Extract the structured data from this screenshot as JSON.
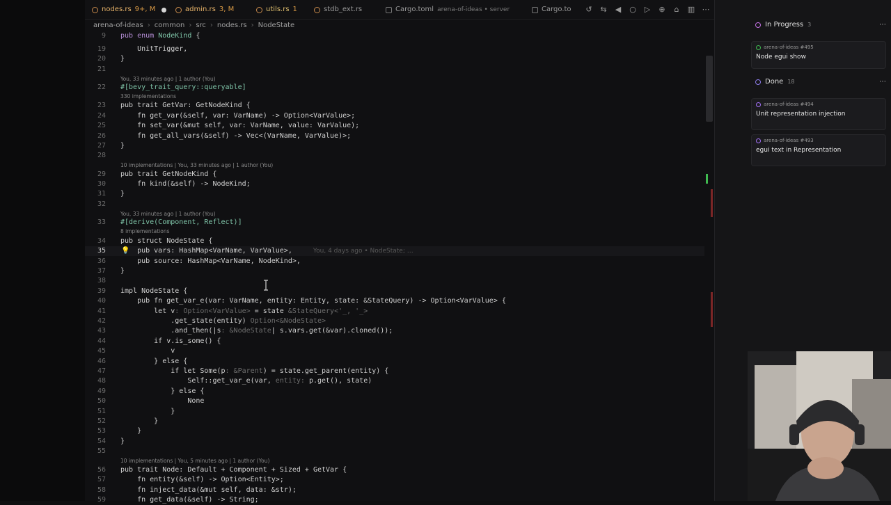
{
  "tabs": [
    {
      "name": "nodes.rs",
      "status": "9+, M",
      "active": true
    },
    {
      "name": "admin.rs",
      "status": "3, M"
    },
    {
      "name": "utils.rs",
      "status": "1"
    },
    {
      "name": "stdb_ext.rs",
      "status": ""
    },
    {
      "name": "Cargo.toml",
      "status": "arena-of-ideas • server"
    },
    {
      "name": "Cargo.to",
      "status": ""
    }
  ],
  "breadcrumb": [
    "arena-of-ideas",
    "common",
    "src",
    "nodes.rs",
    "NodeState"
  ],
  "code": {
    "l9": "pub enum NodeKind {",
    "l19": "    UnitTrigger,",
    "l20": "}",
    "lens22": "You, 33 minutes ago | 1 author (You)",
    "l22": "#[bevy_trait_query::queryable]",
    "lens22b": "330 implementations",
    "l23": "pub trait GetVar: GetNodeKind {",
    "l24": "    fn get_var(&self, var: VarName) -> Option<VarValue>;",
    "l25": "    fn set_var(&mut self, var: VarName, value: VarValue);",
    "l26": "    fn get_all_vars(&self) -> Vec<(VarName, VarValue)>;",
    "l27": "}",
    "lens29": "10 implementations | You, 33 minutes ago | 1 author (You)",
    "l29": "pub trait GetNodeKind {",
    "l30": "    fn kind(&self) -> NodeKind;",
    "l31": "}",
    "lens33": "You, 33 minutes ago | 1 author (You)",
    "l33": "#[derive(Component, Reflect)]",
    "lens33b": "8 implementations",
    "l34": "pub struct NodeState {",
    "l35": "    pub vars: HashMap<VarName, VarValue>,",
    "blame35": "You, 4 days ago • NodeState; …",
    "l36": "    pub source: HashMap<VarName, NodeKind>,",
    "l37": "}",
    "l39": "impl NodeState {",
    "l40": "    pub fn get_var_e(var: VarName, entity: Entity, state: &StateQuery) -> Option<VarValue> {",
    "l41a": "        let v",
    "l41hint": ": Option<VarValue>",
    "l41b": " = state",
    "l41hint2": " &StateQuery<'_, '_>",
    "l42a": "            .get_state(entity)",
    "l42hint": " Option<&NodeState>",
    "l43a": "            .and_then(|s",
    "l43hint": ": &NodeState",
    "l43b": "| s.vars.get(&var).cloned());",
    "l44": "        if v.is_some() {",
    "l45": "            v",
    "l46": "        } else {",
    "l47a": "            if let Some(p",
    "l47hint": ": &Parent",
    "l47b": ") = state.get_parent(entity) {",
    "l48a": "                Self::get_var_e(var, ",
    "l48hint": "entity: ",
    "l48b": "p.get(), state)",
    "l49": "            } else {",
    "l50": "                None",
    "l51": "            }",
    "l52": "        }",
    "l53": "    }",
    "l54": "}",
    "lens56": "10 implementations | You, 5 minutes ago | 1 author (You)",
    "l56": "pub trait Node: Default + Component + Sized + GetVar {",
    "l57": "    fn entity(&self) -> Option<Entity>;",
    "l58": "    fn inject_data(&mut self, data: &str);",
    "l59": "    fn get_data(&self) -> String;"
  },
  "line_numbers": [
    "9",
    "19",
    "20",
    "21",
    "22",
    "23",
    "24",
    "25",
    "26",
    "27",
    "28",
    "29",
    "30",
    "31",
    "32",
    "33",
    "34",
    "35",
    "36",
    "37",
    "38",
    "39",
    "40",
    "41",
    "42",
    "43",
    "44",
    "45",
    "46",
    "47",
    "48",
    "49",
    "50",
    "51",
    "52",
    "53",
    "54",
    "55",
    "56",
    "57",
    "58",
    "59"
  ],
  "current_line": "35",
  "project_panel": {
    "groups": [
      {
        "label": "In Progress",
        "count": "3",
        "cards": [
          {
            "repo": "arena-of-ideas #495",
            "title": "Node egui show"
          }
        ]
      },
      {
        "label": "Done",
        "count": "18",
        "cards": [
          {
            "repo": "arena-of-ideas #494",
            "title": "Unit representation injection"
          },
          {
            "repo": "arena-of-ideas #493",
            "title": "egui text in Representation"
          }
        ]
      }
    ],
    "menu_glyph": "⋯"
  }
}
